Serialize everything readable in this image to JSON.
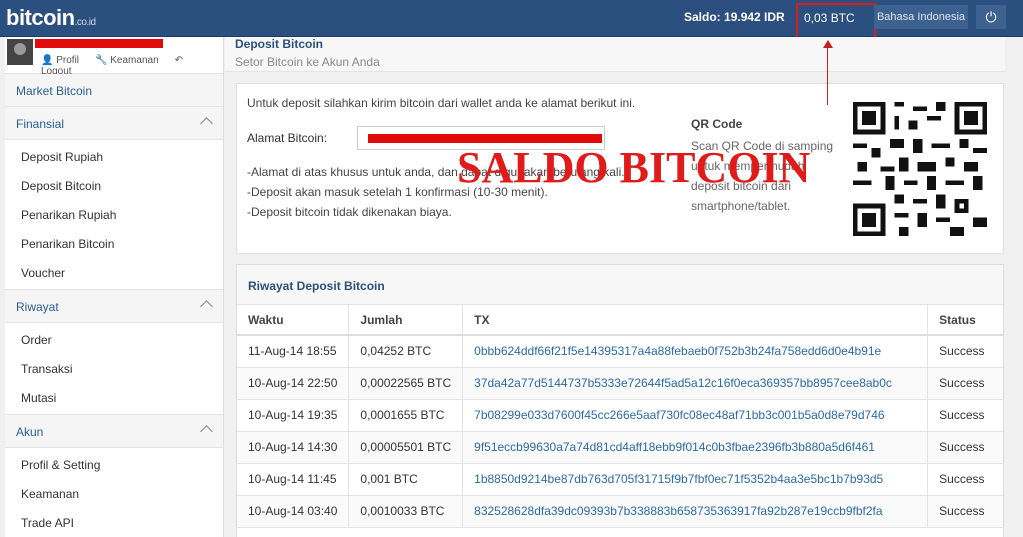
{
  "topbar": {
    "logo_main": "bitcoin",
    "logo_tld": ".co.id",
    "saldo_label": "Saldo:",
    "saldo_idr": "19.942 IDR",
    "saldo_btc": "0,03 BTC",
    "language": "Bahasa Indonesia",
    "power_icon": "power-icon"
  },
  "user": {
    "links": [
      "Profil",
      "Keamanan",
      "Logout"
    ]
  },
  "sidebar": {
    "market": "Market Bitcoin",
    "groups": [
      {
        "title": "Finansial",
        "items": [
          "Deposit Rupiah",
          "Deposit Bitcoin",
          "Penarikan Rupiah",
          "Penarikan Bitcoin",
          "Voucher"
        ]
      },
      {
        "title": "Riwayat",
        "items": [
          "Order",
          "Transaksi",
          "Mutasi"
        ]
      },
      {
        "title": "Akun",
        "items": [
          "Profil & Setting",
          "Keamanan",
          "Trade API"
        ]
      }
    ]
  },
  "page": {
    "title": "Deposit Bitcoin",
    "subtitle": "Setor Bitcoin ke Akun Anda"
  },
  "deposit": {
    "intro": "Untuk deposit silahkan kirim bitcoin dari wallet anda ke alamat berikut ini.",
    "address_label": "Alamat Bitcoin:",
    "notes": [
      "-Alamat di atas khusus untuk anda, dan dapat digunakan berulang kali.",
      "-Deposit akan masuk setelah 1 konfirmasi (10-30 menit).",
      "-Deposit bitcoin tidak dikenakan biaya."
    ],
    "qr_title": "QR Code",
    "qr_text": "Scan QR Code di samping untuk mempermudah deposit bitcoin dari smartphone/tablet.",
    "annotation": "SALDO BITCOIN"
  },
  "history": {
    "title": "Riwayat Deposit Bitcoin",
    "columns": [
      "Waktu",
      "Jumlah",
      "TX",
      "Status"
    ],
    "rows": [
      [
        "11-Aug-14 18:55",
        "0,04252 BTC",
        "0bbb624ddf66f21f5e14395317a4a88febaeb0f752b3b24fa758edd6d0e4b91e",
        "Success"
      ],
      [
        "10-Aug-14 22:50",
        "0,00022565 BTC",
        "37da42a77d5144737b5333e72644f5ad5a12c16f0eca369357bb8957cee8ab0c",
        "Success"
      ],
      [
        "10-Aug-14 19:35",
        "0,0001655 BTC",
        "7b08299e033d7600f45cc266e5aaf730fc08ec48af71bb3c001b5a0d8e79d746",
        "Success"
      ],
      [
        "10-Aug-14 14:30",
        "0,00005501 BTC",
        "9f51eccb99630a7a74d81cd4aff18ebb9f014c0b3fbae2396fb3b880a5d6f461",
        "Success"
      ],
      [
        "10-Aug-14 11:45",
        "0,001 BTC",
        "1b8850d9214be87db763d705f31715f9b7fbf0ec71f5352b4aa3e5bc1b7b93d5",
        "Success"
      ],
      [
        "10-Aug-14 03:40",
        "0,0010033 BTC",
        "832528628dfa39dc09393b7b338883b658735363917fa92b287e19ccb9fbf2fa",
        "Success"
      ]
    ]
  }
}
